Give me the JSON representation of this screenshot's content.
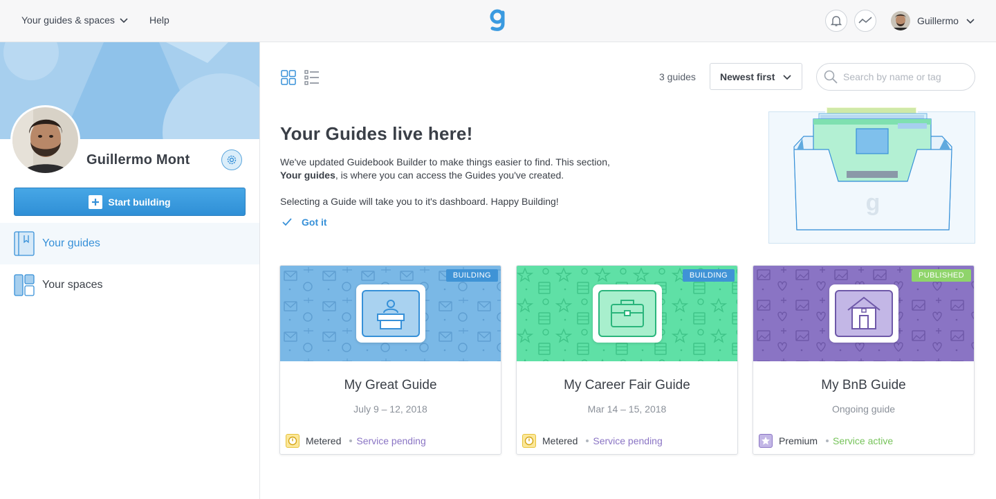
{
  "topbar": {
    "menu_label": "Your guides & spaces",
    "help_label": "Help",
    "user_name": "Guillermo"
  },
  "sidebar": {
    "profile_name": "Guillermo Mont",
    "start_button": "Start building",
    "items": [
      {
        "label": "Your guides",
        "active": true
      },
      {
        "label": "Your spaces",
        "active": false
      }
    ]
  },
  "toolbar": {
    "count": "3 guides",
    "sort_selected": "Newest first",
    "search_placeholder": "Search by name or tag"
  },
  "hero": {
    "title": "Your Guides live here!",
    "line1": "We've updated Guidebook Builder to make things easier to find. This section,",
    "line2_bold": "Your guides",
    "line2_rest": ", is where you can access the Guides you've created.",
    "line3": "Selecting a Guide will take you to it's dashboard. Happy Building!",
    "got_it": "Got it"
  },
  "guides": [
    {
      "title": "My Great Guide",
      "date": "July 9 – 12, 2018",
      "status": "BUILDING",
      "plan": "Metered",
      "service": "Service pending",
      "color": "#7ab8e6"
    },
    {
      "title": "My Career Fair Guide",
      "date": "Mar 14 – 15, 2018",
      "status": "BUILDING",
      "plan": "Metered",
      "service": "Service pending",
      "color": "#5fe0a6"
    },
    {
      "title": "My BnB Guide",
      "date": "Ongoing guide",
      "status": "PUBLISHED",
      "plan": "Premium",
      "service": "Service active",
      "color": "#8a74c4"
    }
  ],
  "colors": {
    "accent": "#3690d8",
    "building_badge": "#3f93d6",
    "published_badge": "#8fd46b",
    "pending": "#8a74c4",
    "active": "#76c35a"
  }
}
